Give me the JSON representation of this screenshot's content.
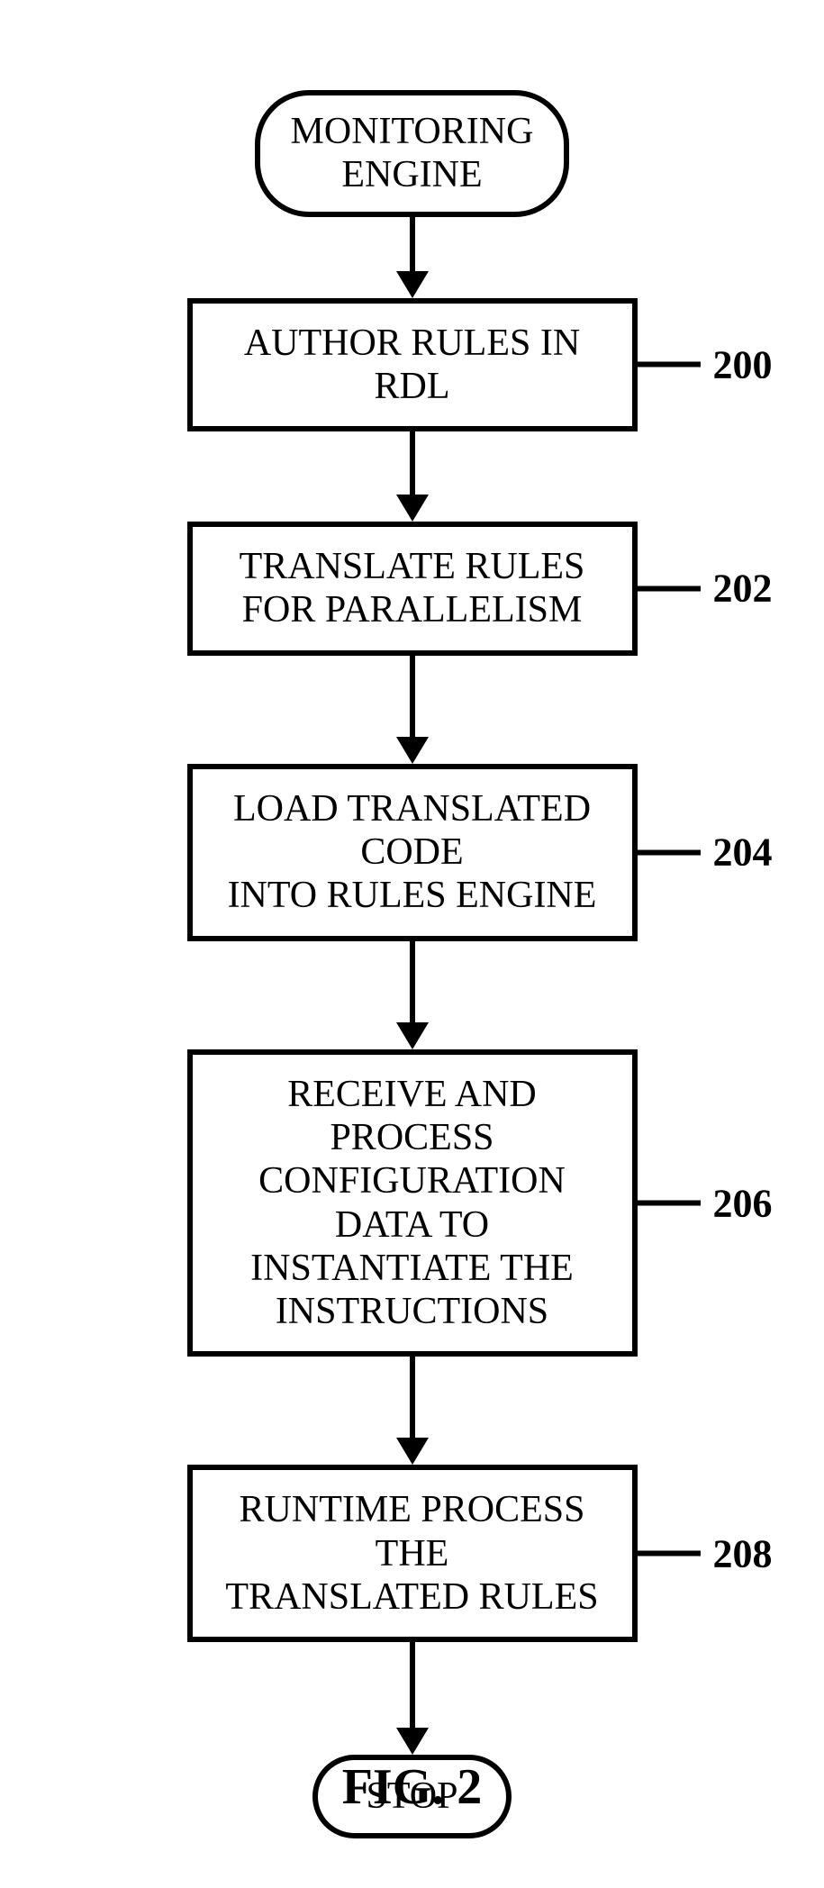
{
  "flow": {
    "start": "MONITORING\nENGINE",
    "steps": [
      {
        "text": "AUTHOR RULES IN RDL",
        "ref": "200"
      },
      {
        "text": "TRANSLATE RULES\nFOR PARALLELISM",
        "ref": "202"
      },
      {
        "text": "LOAD TRANSLATED CODE\nINTO RULES ENGINE",
        "ref": "204"
      },
      {
        "text": "RECEIVE AND PROCESS\nCONFIGURATION DATA TO\nINSTANTIATE THE\nINSTRUCTIONS",
        "ref": "206"
      },
      {
        "text": "RUNTIME PROCESS THE\nTRANSLATED RULES",
        "ref": "208"
      }
    ],
    "stop": "STOP"
  },
  "caption": "FIG. 2"
}
